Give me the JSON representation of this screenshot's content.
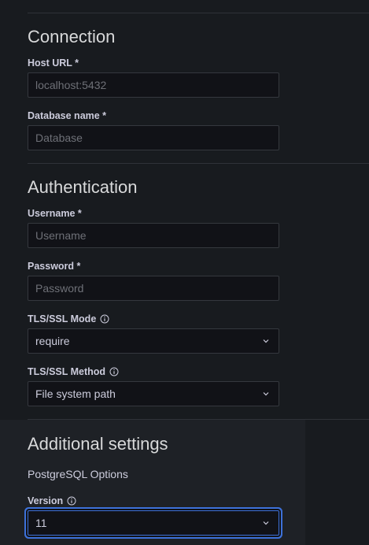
{
  "connection": {
    "title": "Connection",
    "host_label": "Host URL *",
    "host_placeholder": "localhost:5432",
    "db_label": "Database name *",
    "db_placeholder": "Database"
  },
  "authentication": {
    "title": "Authentication",
    "username_label": "Username *",
    "username_placeholder": "Username",
    "password_label": "Password *",
    "password_placeholder": "Password",
    "tls_mode_label": "TLS/SSL Mode",
    "tls_mode_value": "require",
    "tls_method_label": "TLS/SSL Method",
    "tls_method_value": "File system path"
  },
  "additional": {
    "title": "Additional settings",
    "subtitle": "PostgreSQL Options",
    "version_label": "Version",
    "version_value": "11"
  },
  "icons": {
    "info": "info-circle-icon",
    "chevron": "chevron-down-icon"
  },
  "colors": {
    "background": "#181b1f",
    "input_bg": "#111217",
    "border": "#35383e",
    "focus": "#3d71d9"
  }
}
